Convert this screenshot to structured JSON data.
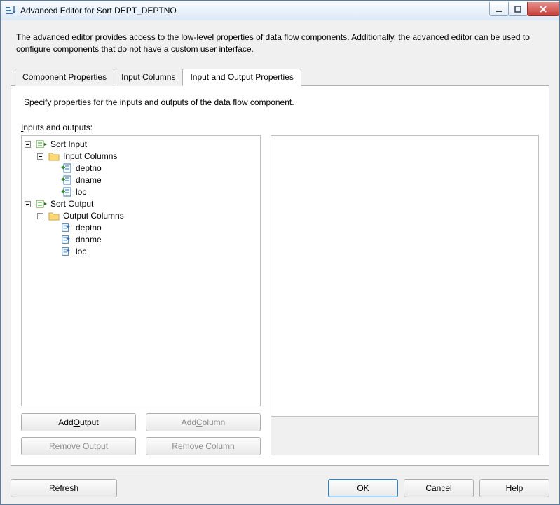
{
  "window": {
    "title": "Advanced Editor for Sort DEPT_DEPTNO"
  },
  "description": "The advanced editor provides access to the low-level properties of data flow components. Additionally, the advanced editor can be used to configure components that do not have a custom user interface.",
  "tabs": [
    {
      "label": "Component Properties",
      "active": false
    },
    {
      "label": "Input Columns",
      "active": false
    },
    {
      "label": "Input and Output Properties",
      "active": true
    }
  ],
  "panel": {
    "description": "Specify properties for the inputs and outputs of the data flow component.",
    "io_label_pre": "I",
    "io_label_rest": "nputs and outputs:"
  },
  "tree": {
    "sort_input": "Sort Input",
    "input_columns": "Input Columns",
    "in_deptno": "deptno",
    "in_dname": "dname",
    "in_loc": "loc",
    "sort_output": "Sort Output",
    "output_columns": "Output Columns",
    "out_deptno": "deptno",
    "out_dname": "dname",
    "out_loc": "loc"
  },
  "buttons": {
    "add_output_pre": "Add ",
    "add_output_u": "O",
    "add_output_post": "utput",
    "add_column_pre": "Add ",
    "add_column_u": "C",
    "add_column_post": "olumn",
    "remove_output_pre": "R",
    "remove_output_u": "e",
    "remove_output_post": "move Output",
    "remove_column_pre": "Remove Colu",
    "remove_column_u": "m",
    "remove_column_post": "n",
    "refresh": "Refresh",
    "ok": "OK",
    "cancel": "Cancel",
    "help_u": "H",
    "help_rest": "elp"
  }
}
